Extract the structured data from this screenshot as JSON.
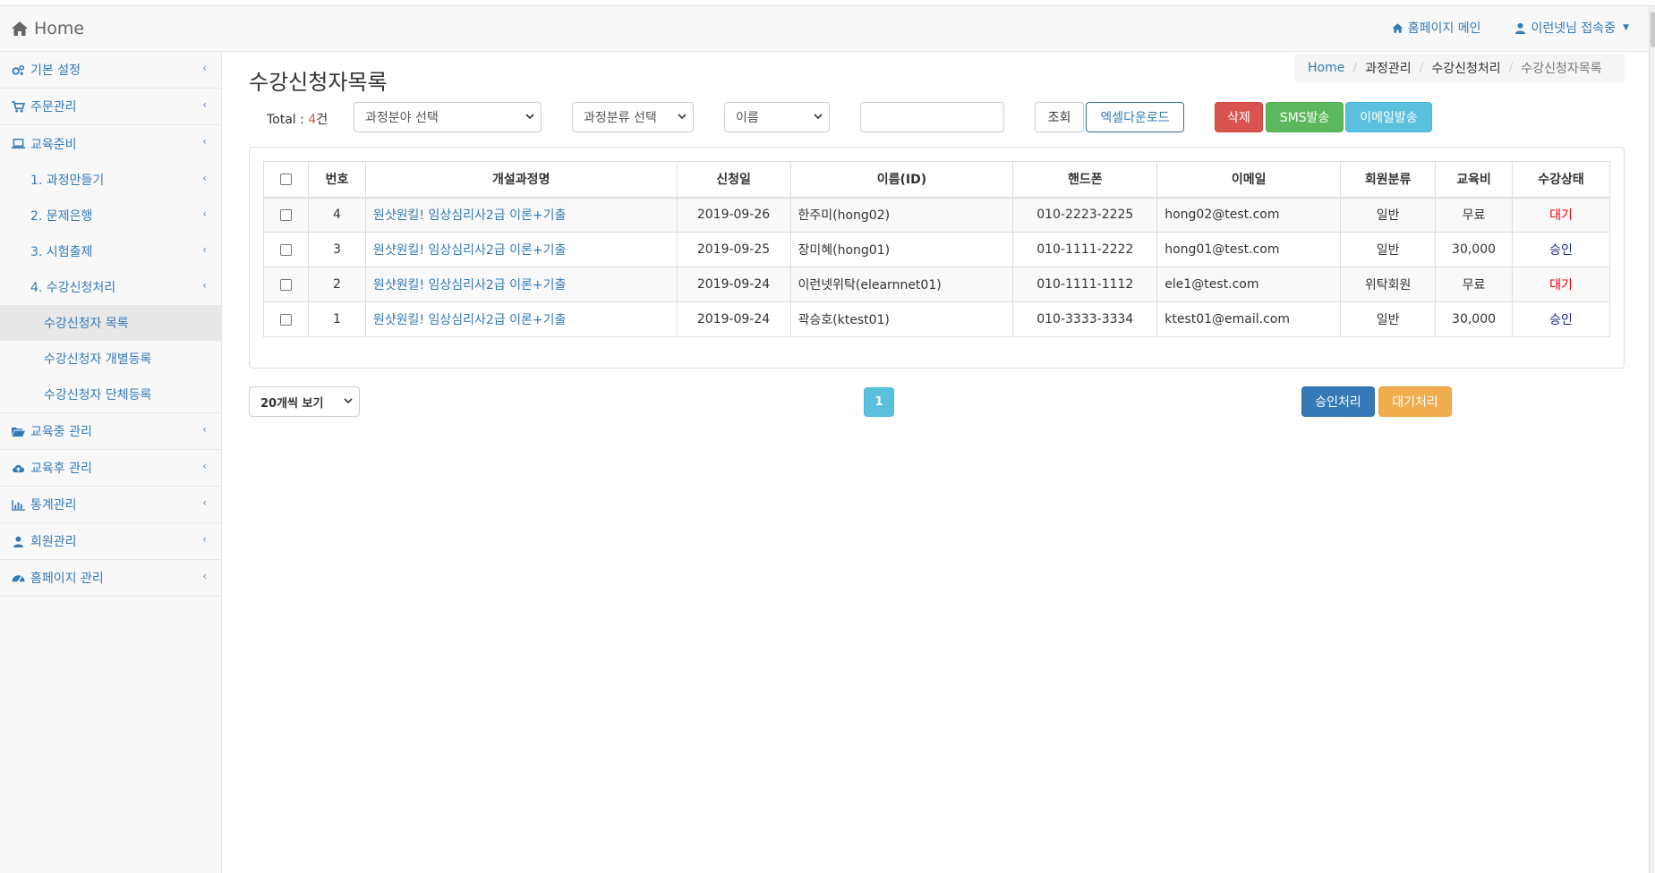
{
  "header": {
    "brand": "Home",
    "homepage_link": "홈페이지 메인",
    "user_link": "이런넷님 접속중"
  },
  "sidebar": {
    "items": [
      {
        "label": "기본 설정",
        "icon": "gears-icon"
      },
      {
        "label": "주문관리",
        "icon": "cart-icon"
      },
      {
        "label": "교육준비",
        "icon": "laptop-icon"
      },
      {
        "label": "1. 과정만들기"
      },
      {
        "label": "2. 문제은행"
      },
      {
        "label": "3. 시험출제"
      },
      {
        "label": "4. 수강신청처리"
      },
      {
        "label": "수강신청자 목록"
      },
      {
        "label": "수강신청자 개별등록"
      },
      {
        "label": "수강신청자 단체등록"
      },
      {
        "label": "교육중 관리",
        "icon": "folder-open-icon"
      },
      {
        "label": "교육후 관리",
        "icon": "cloud-upload-icon"
      },
      {
        "label": "통계관리",
        "icon": "bar-chart-icon"
      },
      {
        "label": "회원관리",
        "icon": "user-icon"
      },
      {
        "label": "홈페이지 관리",
        "icon": "dashboard-icon"
      }
    ]
  },
  "page": {
    "title": "수강신청자목록",
    "breadcrumb": [
      "Home",
      "과정관리",
      "수강신청처리",
      "수강신청자목록"
    ]
  },
  "filters": {
    "total_label": "Total : ",
    "total_count": "4",
    "total_unit": "건",
    "field_select": "과정분야 선택",
    "category_select": "과정분류 선택",
    "search_type_select": "이름",
    "search_value": "",
    "search_button": "조회",
    "excel_button": "엑셀다운로드",
    "delete_button": "삭제",
    "sms_button": "SMS발송",
    "email_button": "이메일발송"
  },
  "table": {
    "headers": [
      "번호",
      "개설과정명",
      "신청일",
      "이름(ID)",
      "핸드폰",
      "이메일",
      "회원분류",
      "교육비",
      "수강상태"
    ],
    "rows": [
      {
        "no": "4",
        "course": "원샷원킬! 임상심리사2급 이론+기출",
        "date": "2019-09-26",
        "name": "한주미(hong02)",
        "phone": "010-2223-2225",
        "email": "hong02@test.com",
        "member_type": "일반",
        "fee": "무료",
        "status": "대기"
      },
      {
        "no": "3",
        "course": "원샷원킬! 임상심리사2급 이론+기출",
        "date": "2019-09-25",
        "name": "장미혜(hong01)",
        "phone": "010-1111-2222",
        "email": "hong01@test.com",
        "member_type": "일반",
        "fee": "30,000",
        "status": "승인"
      },
      {
        "no": "2",
        "course": "원샷원킬! 임상심리사2급 이론+기출",
        "date": "2019-09-24",
        "name": "이런넷위탁(elearnnet01)",
        "phone": "010-1111-1112",
        "email": "ele1@test.com",
        "member_type": "위탁회원",
        "fee": "무료",
        "status": "대기"
      },
      {
        "no": "1",
        "course": "원샷원킬! 임상심리사2급 이론+기출",
        "date": "2019-09-24",
        "name": "곽승호(ktest01)",
        "phone": "010-3333-3334",
        "email": "ktest01@email.com",
        "member_type": "일반",
        "fee": "30,000",
        "status": "승인"
      }
    ]
  },
  "footer": {
    "page_size_select": "20개씩 보기",
    "current_page": "1",
    "approve_button": "승인처리",
    "wait_button": "대기처리"
  },
  "colors": {
    "link": "#337ab7",
    "danger": "#d9534f",
    "success": "#5cb85c",
    "info": "#5bc0de",
    "warning": "#f0ad4e",
    "status_wait": "#ee0000",
    "status_approved": "#1d2a8a"
  }
}
